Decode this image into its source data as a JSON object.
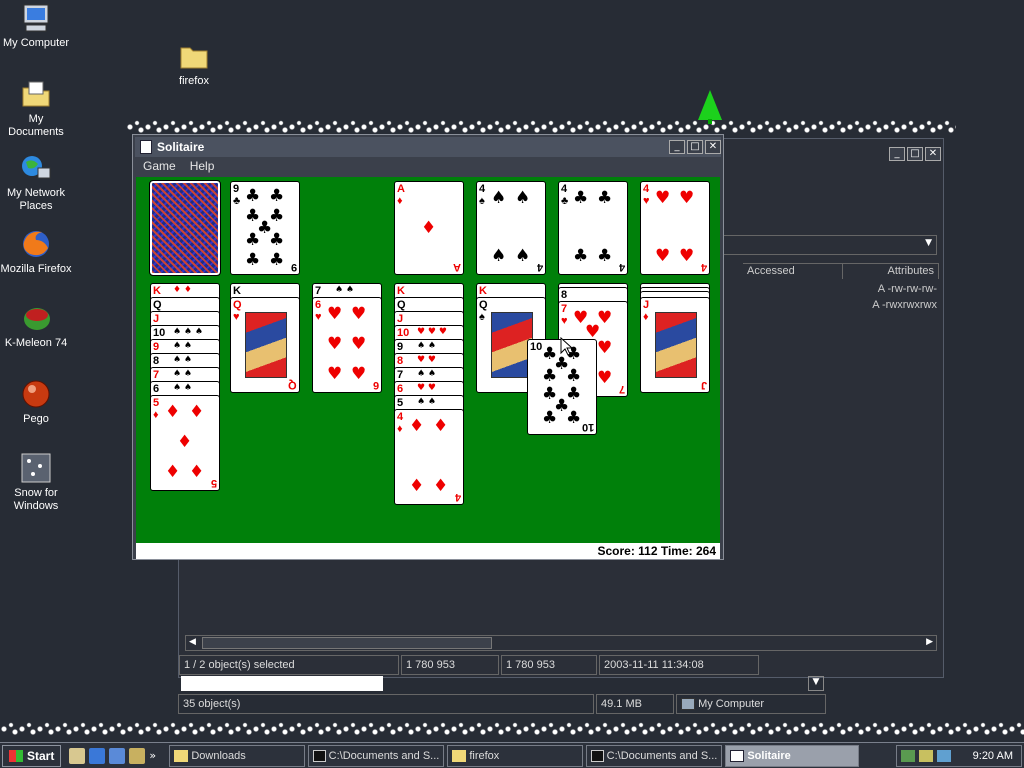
{
  "desktop": {
    "icons": [
      {
        "label": "My Computer",
        "icon": "computer-icon"
      },
      {
        "label": "firefox",
        "icon": "folder-icon"
      },
      {
        "label": "My Documents",
        "icon": "documents-icon"
      },
      {
        "label": "My Network Places",
        "icon": "network-icon"
      },
      {
        "label": "Mozilla Firefox",
        "icon": "firefox-icon"
      },
      {
        "label": "K-Meleon 74",
        "icon": "kmeleon-icon"
      },
      {
        "label": "Pego",
        "icon": "pego-icon"
      },
      {
        "label": "Snow for Windows",
        "icon": "snow-icon"
      }
    ]
  },
  "explorer": {
    "columns": [
      "Accessed",
      "Attributes"
    ],
    "attributes": [
      "A -rw-rw-rw-",
      "A -rwxrwxrwx"
    ],
    "status": [
      "1 / 2 object(s) selected",
      "1 780 953",
      "1 780 953",
      "2003-11-11 11:34:08"
    ],
    "status2": [
      "35 object(s)",
      "49.1 MB",
      "My Computer"
    ]
  },
  "solitaire": {
    "title": "Solitaire",
    "menu": [
      "Game",
      "Help"
    ],
    "status": "Score: 112 Time: 264",
    "accent": "#00800a"
  },
  "taskbar": {
    "start": "Start",
    "buttons": [
      {
        "label": "Downloads",
        "icon": "folder-icon"
      },
      {
        "label": "C:\\Documents and S...",
        "icon": "7zip-icon"
      },
      {
        "label": "firefox",
        "icon": "folder-icon"
      },
      {
        "label": "C:\\Documents and S...",
        "icon": "7zip-icon"
      },
      {
        "label": "Solitaire",
        "icon": "solitaire-icon",
        "active": true
      }
    ],
    "clock": "9:20 AM"
  }
}
